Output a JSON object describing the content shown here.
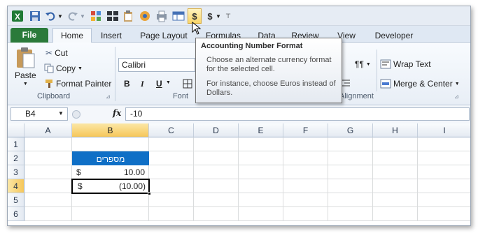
{
  "qat": {
    "currency_symbol": "$"
  },
  "tabs": [
    "File",
    "Home",
    "Insert",
    "Page Layout",
    "Formulas",
    "Data",
    "Review",
    "View",
    "Developer"
  ],
  "clipboard": {
    "paste": "Paste",
    "cut": "Cut",
    "copy": "Copy",
    "format_painter": "Format Painter",
    "group_label": "Clipboard"
  },
  "font": {
    "name": "Calibri",
    "bold": "B",
    "italic": "I",
    "underline": "U",
    "group_label": "Font"
  },
  "alignment": {
    "wrap_text": "Wrap Text",
    "merge_center": "Merge & Center",
    "group_label": "Alignment",
    "para": "¶¶"
  },
  "tooltip": {
    "title": "Accounting Number Format",
    "body": "Choose an alternate currency format for the selected cell.",
    "body2": "For instance, choose Euros instead of Dollars."
  },
  "formula_bar": {
    "name_box": "B4",
    "fx": "fx",
    "value": "-10"
  },
  "grid": {
    "columns": [
      "A",
      "B",
      "C",
      "D",
      "E",
      "F",
      "G",
      "H",
      "I"
    ],
    "rows": [
      "1",
      "2",
      "3",
      "4",
      "5",
      "6"
    ],
    "b2": "מספרים",
    "b3_symbol": "$",
    "b3_value": "10.00",
    "b4_symbol": "$",
    "b4_value": "(10.00)"
  },
  "colors": {
    "file_tab": "#2a7a3a",
    "table_header": "#0f6fc6",
    "selection": "#f6c75a"
  }
}
